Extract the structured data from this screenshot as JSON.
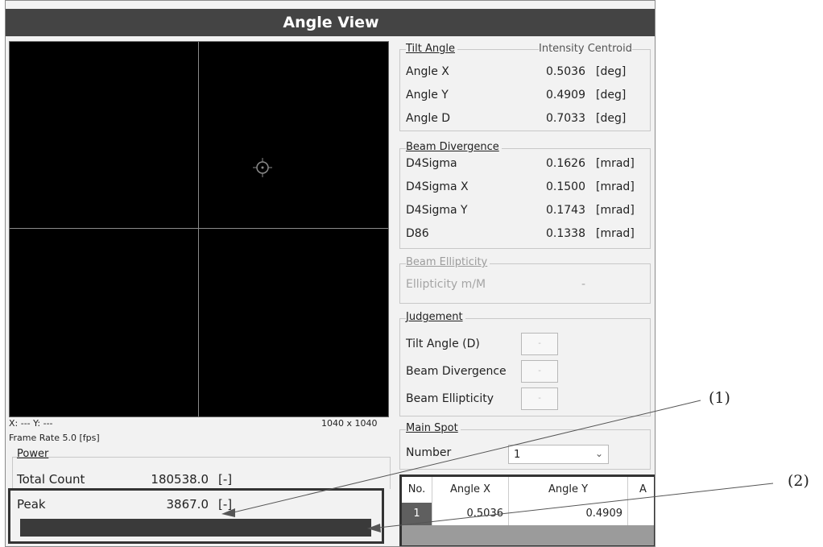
{
  "window": {
    "title": "Angle View"
  },
  "image": {
    "cursor_readout": "X: --- Y: ---",
    "resolution": "1040 x 1040",
    "frame_rate": "Frame Rate  5.0  [fps]"
  },
  "power": {
    "title": "Power",
    "total_label": "Total Count",
    "total_value": "180538.0",
    "total_unit": "[-]",
    "peak_label": "Peak",
    "peak_value": "3867.0",
    "peak_unit": "[-]",
    "peak_bar_fraction": 1.0
  },
  "tilt_angle": {
    "title": "Tilt Angle",
    "mode": "Intensity Centroid",
    "rows": [
      {
        "label": "Angle X",
        "value": "0.5036",
        "unit": "[deg]"
      },
      {
        "label": "Angle Y",
        "value": "0.4909",
        "unit": "[deg]"
      },
      {
        "label": "Angle D",
        "value": "0.7033",
        "unit": "[deg]"
      }
    ]
  },
  "beam_divergence": {
    "title": "Beam Divergence",
    "rows": [
      {
        "label": "D4Sigma",
        "value": "0.1626",
        "unit": "[mrad]"
      },
      {
        "label": "D4Sigma X",
        "value": "0.1500",
        "unit": "[mrad]"
      },
      {
        "label": "D4Sigma Y",
        "value": "0.1743",
        "unit": "[mrad]"
      },
      {
        "label": "D86",
        "value": "0.1338",
        "unit": "[mrad]"
      }
    ]
  },
  "beam_ellipticity": {
    "title": "Beam Ellipticity",
    "label": "Ellipticity m/M",
    "value": "-"
  },
  "judgement": {
    "title": "Judgement",
    "rows": [
      {
        "label": "Tilt Angle (D)",
        "indicator": "-"
      },
      {
        "label": "Beam Divergence",
        "indicator": "-"
      },
      {
        "label": "Beam Ellipticity",
        "indicator": "-"
      }
    ]
  },
  "main_spot": {
    "title": "Main Spot",
    "number_label": "Number",
    "number_value": "1"
  },
  "table": {
    "headers": [
      "No.",
      "Angle X",
      "Angle Y",
      "A"
    ],
    "rows": [
      {
        "no": "1",
        "angle_x": "0.5036",
        "angle_y": "0.4909"
      }
    ]
  },
  "callouts": {
    "label_1": "(1)",
    "label_2": "(2)"
  }
}
